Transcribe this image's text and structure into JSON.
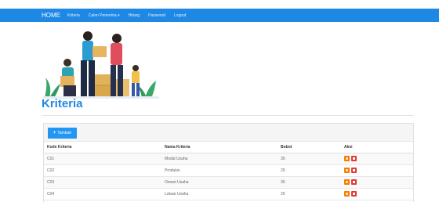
{
  "navbar": {
    "brand": "HOME",
    "items": [
      "Kriteria",
      "Calon Penerima ▾",
      "Hitung",
      "Password",
      "Logout"
    ]
  },
  "page": {
    "title": "Kriteria"
  },
  "toolbar": {
    "add_label": "Tambah",
    "add_icon": "plus-icon"
  },
  "table": {
    "headers": [
      "Kode Kriteria",
      "Nama Kriteria",
      "Bobot",
      "Aksi"
    ],
    "rows": [
      {
        "code": "C01",
        "name": "Modal Usaha",
        "weight": "30"
      },
      {
        "code": "C02",
        "name": "Produksi",
        "weight": "20"
      },
      {
        "code": "C03",
        "name": "Omset Usaha",
        "weight": "30"
      },
      {
        "code": "C04",
        "name": "Lokasi Usaha",
        "weight": "20"
      }
    ],
    "action_icons": [
      "edit-icon",
      "delete-icon"
    ]
  },
  "colors": {
    "navbar": "#1e88e5",
    "title": "#1e88e5",
    "add_button": "#2196f3",
    "edit_button": "#f57c00",
    "delete_button": "#e53935"
  }
}
